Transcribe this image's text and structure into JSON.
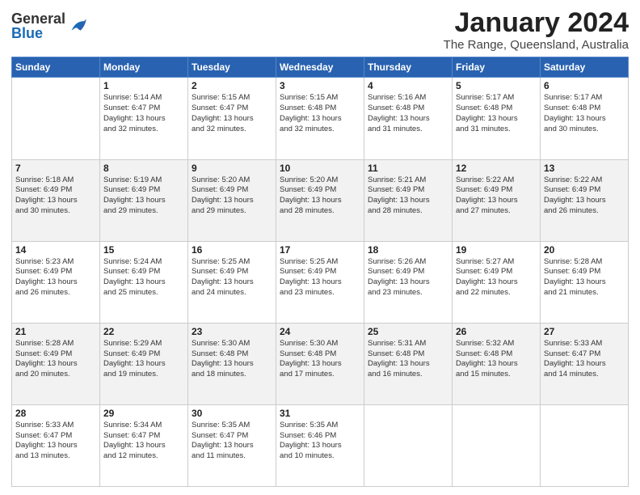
{
  "logo": {
    "general": "General",
    "blue": "Blue"
  },
  "title": "January 2024",
  "location": "The Range, Queensland, Australia",
  "weekdays": [
    "Sunday",
    "Monday",
    "Tuesday",
    "Wednesday",
    "Thursday",
    "Friday",
    "Saturday"
  ],
  "weeks": [
    [
      {
        "num": "",
        "info": ""
      },
      {
        "num": "1",
        "info": "Sunrise: 5:14 AM\nSunset: 6:47 PM\nDaylight: 13 hours\nand 32 minutes."
      },
      {
        "num": "2",
        "info": "Sunrise: 5:15 AM\nSunset: 6:47 PM\nDaylight: 13 hours\nand 32 minutes."
      },
      {
        "num": "3",
        "info": "Sunrise: 5:15 AM\nSunset: 6:48 PM\nDaylight: 13 hours\nand 32 minutes."
      },
      {
        "num": "4",
        "info": "Sunrise: 5:16 AM\nSunset: 6:48 PM\nDaylight: 13 hours\nand 31 minutes."
      },
      {
        "num": "5",
        "info": "Sunrise: 5:17 AM\nSunset: 6:48 PM\nDaylight: 13 hours\nand 31 minutes."
      },
      {
        "num": "6",
        "info": "Sunrise: 5:17 AM\nSunset: 6:48 PM\nDaylight: 13 hours\nand 30 minutes."
      }
    ],
    [
      {
        "num": "7",
        "info": "Sunrise: 5:18 AM\nSunset: 6:49 PM\nDaylight: 13 hours\nand 30 minutes."
      },
      {
        "num": "8",
        "info": "Sunrise: 5:19 AM\nSunset: 6:49 PM\nDaylight: 13 hours\nand 29 minutes."
      },
      {
        "num": "9",
        "info": "Sunrise: 5:20 AM\nSunset: 6:49 PM\nDaylight: 13 hours\nand 29 minutes."
      },
      {
        "num": "10",
        "info": "Sunrise: 5:20 AM\nSunset: 6:49 PM\nDaylight: 13 hours\nand 28 minutes."
      },
      {
        "num": "11",
        "info": "Sunrise: 5:21 AM\nSunset: 6:49 PM\nDaylight: 13 hours\nand 28 minutes."
      },
      {
        "num": "12",
        "info": "Sunrise: 5:22 AM\nSunset: 6:49 PM\nDaylight: 13 hours\nand 27 minutes."
      },
      {
        "num": "13",
        "info": "Sunrise: 5:22 AM\nSunset: 6:49 PM\nDaylight: 13 hours\nand 26 minutes."
      }
    ],
    [
      {
        "num": "14",
        "info": "Sunrise: 5:23 AM\nSunset: 6:49 PM\nDaylight: 13 hours\nand 26 minutes."
      },
      {
        "num": "15",
        "info": "Sunrise: 5:24 AM\nSunset: 6:49 PM\nDaylight: 13 hours\nand 25 minutes."
      },
      {
        "num": "16",
        "info": "Sunrise: 5:25 AM\nSunset: 6:49 PM\nDaylight: 13 hours\nand 24 minutes."
      },
      {
        "num": "17",
        "info": "Sunrise: 5:25 AM\nSunset: 6:49 PM\nDaylight: 13 hours\nand 23 minutes."
      },
      {
        "num": "18",
        "info": "Sunrise: 5:26 AM\nSunset: 6:49 PM\nDaylight: 13 hours\nand 23 minutes."
      },
      {
        "num": "19",
        "info": "Sunrise: 5:27 AM\nSunset: 6:49 PM\nDaylight: 13 hours\nand 22 minutes."
      },
      {
        "num": "20",
        "info": "Sunrise: 5:28 AM\nSunset: 6:49 PM\nDaylight: 13 hours\nand 21 minutes."
      }
    ],
    [
      {
        "num": "21",
        "info": "Sunrise: 5:28 AM\nSunset: 6:49 PM\nDaylight: 13 hours\nand 20 minutes."
      },
      {
        "num": "22",
        "info": "Sunrise: 5:29 AM\nSunset: 6:49 PM\nDaylight: 13 hours\nand 19 minutes."
      },
      {
        "num": "23",
        "info": "Sunrise: 5:30 AM\nSunset: 6:48 PM\nDaylight: 13 hours\nand 18 minutes."
      },
      {
        "num": "24",
        "info": "Sunrise: 5:30 AM\nSunset: 6:48 PM\nDaylight: 13 hours\nand 17 minutes."
      },
      {
        "num": "25",
        "info": "Sunrise: 5:31 AM\nSunset: 6:48 PM\nDaylight: 13 hours\nand 16 minutes."
      },
      {
        "num": "26",
        "info": "Sunrise: 5:32 AM\nSunset: 6:48 PM\nDaylight: 13 hours\nand 15 minutes."
      },
      {
        "num": "27",
        "info": "Sunrise: 5:33 AM\nSunset: 6:47 PM\nDaylight: 13 hours\nand 14 minutes."
      }
    ],
    [
      {
        "num": "28",
        "info": "Sunrise: 5:33 AM\nSunset: 6:47 PM\nDaylight: 13 hours\nand 13 minutes."
      },
      {
        "num": "29",
        "info": "Sunrise: 5:34 AM\nSunset: 6:47 PM\nDaylight: 13 hours\nand 12 minutes."
      },
      {
        "num": "30",
        "info": "Sunrise: 5:35 AM\nSunset: 6:47 PM\nDaylight: 13 hours\nand 11 minutes."
      },
      {
        "num": "31",
        "info": "Sunrise: 5:35 AM\nSunset: 6:46 PM\nDaylight: 13 hours\nand 10 minutes."
      },
      {
        "num": "",
        "info": ""
      },
      {
        "num": "",
        "info": ""
      },
      {
        "num": "",
        "info": ""
      }
    ]
  ]
}
